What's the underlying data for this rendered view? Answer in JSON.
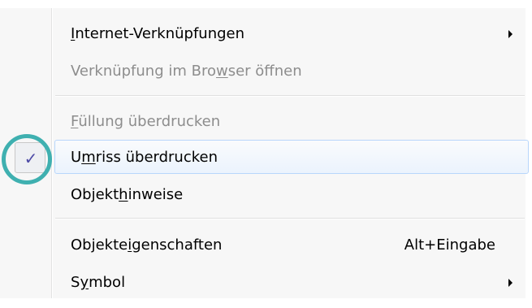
{
  "menu": {
    "items": [
      {
        "parts": [
          {
            "t": "I",
            "u": true
          },
          {
            "t": "nternet-Verknüpfungen"
          }
        ],
        "enabled": true,
        "submenu": true
      },
      {
        "parts": [
          {
            "t": "Verknüpfung im Bro"
          },
          {
            "t": "w",
            "u": true
          },
          {
            "t": "ser öffnen"
          }
        ],
        "enabled": false
      },
      {
        "parts": [
          {
            "t": "F",
            "u": true
          },
          {
            "t": "üllung überdrucken"
          }
        ],
        "enabled": false
      },
      {
        "parts": [
          {
            "t": "U"
          },
          {
            "t": "m",
            "u": true
          },
          {
            "t": "riss überdrucken"
          }
        ],
        "enabled": true,
        "checked": true,
        "highlighted": true
      },
      {
        "parts": [
          {
            "t": "Objekt"
          },
          {
            "t": "h",
            "u": true
          },
          {
            "t": "inweise"
          }
        ],
        "enabled": true
      },
      {
        "parts": [
          {
            "t": "Objekte"
          },
          {
            "t": "i",
            "u": true
          },
          {
            "t": "genschaften"
          }
        ],
        "enabled": true,
        "shortcut": "Alt+Eingabe"
      },
      {
        "parts": [
          {
            "t": "S"
          },
          {
            "t": "y",
            "u": true
          },
          {
            "t": "mbol"
          }
        ],
        "enabled": true,
        "submenu": true
      }
    ],
    "check_glyph": "✓"
  }
}
